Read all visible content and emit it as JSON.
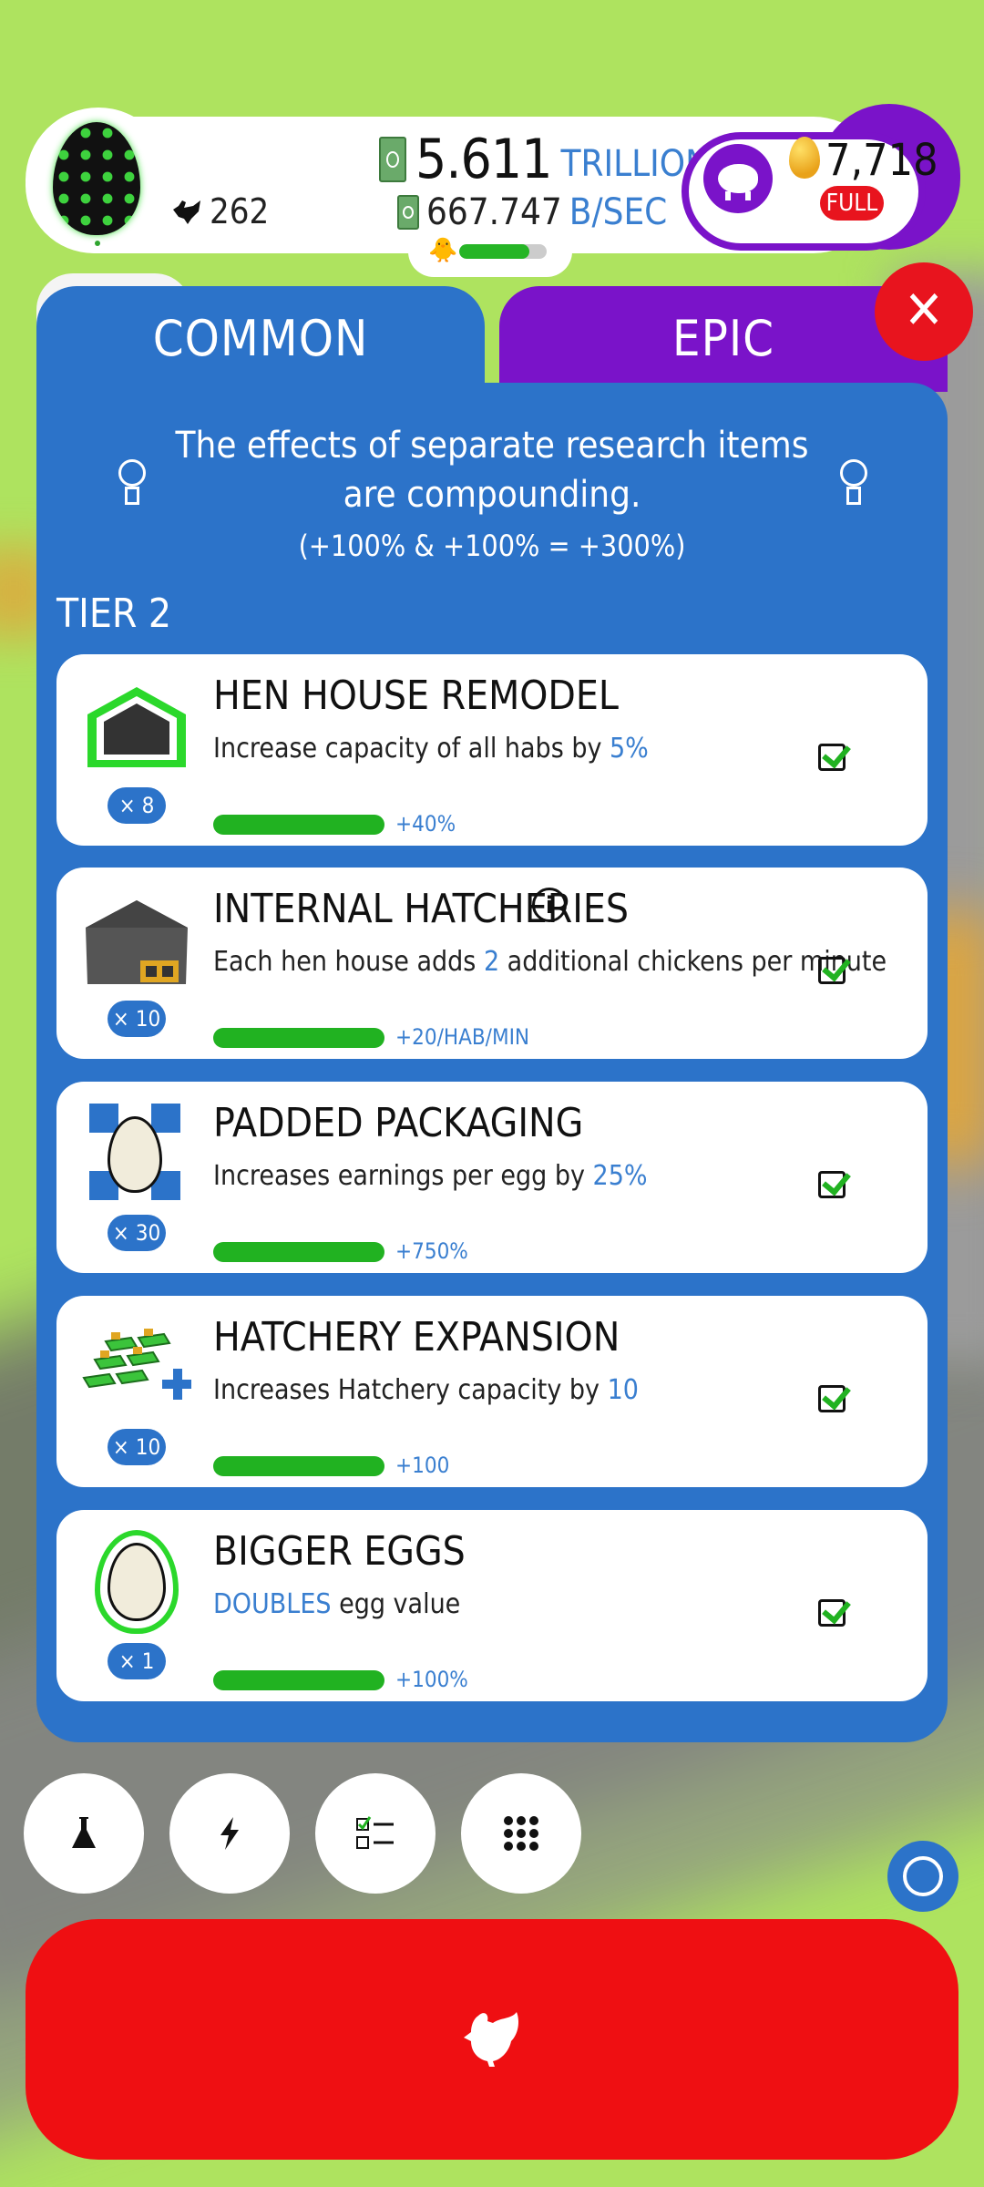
{
  "hud": {
    "chicken_count": "262",
    "money_value": "5.611",
    "money_unit": "TRILLION",
    "rate_value": "667.747",
    "rate_unit": "B/SEC",
    "golden_eggs": "7,718",
    "silo_status": "FULL"
  },
  "tabs": [
    {
      "label": "COMMON"
    },
    {
      "label": "EPIC"
    }
  ],
  "info": {
    "text": "The effects of separate research items are compounding.",
    "example": "(+100% & +100% = +300%)"
  },
  "tier_label": "TIER 2",
  "research": [
    {
      "title": "HEN HOUSE REMODEL",
      "desc_pre": "Increase capacity of all habs by ",
      "desc_accent": "5%",
      "desc_post": "",
      "count": "× 8",
      "bonus": "+40%",
      "icon": "hen-house-icon"
    },
    {
      "title": "INTERNAL HATCHERIES",
      "desc_pre": "Each hen house adds ",
      "desc_accent": "2",
      "desc_post": " additional chickens per minute",
      "count": "× 10",
      "bonus": "+20/HAB/MIN",
      "icon": "hatchery-house-icon"
    },
    {
      "title": "PADDED PACKAGING",
      "desc_pre": "Increases earnings per egg by ",
      "desc_accent": "25%",
      "desc_post": "",
      "count": "× 30",
      "bonus": "+750%",
      "icon": "padded-egg-icon"
    },
    {
      "title": "HATCHERY EXPANSION",
      "desc_pre": "Increases Hatchery capacity by ",
      "desc_accent": "10",
      "desc_post": "",
      "count": "× 10",
      "bonus": "+100",
      "icon": "hatchery-beds-icon"
    },
    {
      "title": "BIGGER EGGS",
      "desc_pre": "",
      "desc_accent": "DOUBLES",
      "desc_post": " egg value",
      "count": "× 1",
      "bonus": "+100%",
      "icon": "bigger-egg-icon"
    }
  ],
  "colors": {
    "panel_blue": "#2c73c9",
    "epic_purple": "#7a13c9",
    "action_red": "#ef0f12",
    "progress_green": "#21b221"
  }
}
